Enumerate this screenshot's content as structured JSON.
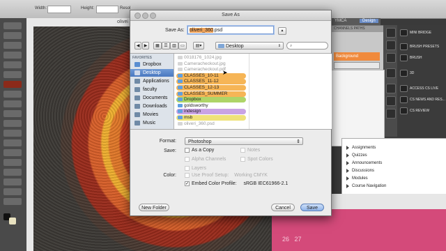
{
  "photoshop": {
    "options_bar": {
      "width_label": "Width:",
      "height_label": "Height:",
      "resolution_prefix": "Resol"
    },
    "doc_tab": "olivei",
    "panels": {
      "tabs": [
        "YMCA",
        "Design"
      ],
      "paths_label": "CHANNELS PATHS",
      "layer_label": "Background"
    },
    "extensions": [
      "MINI BRIDGE",
      "BRUSH PRESETS",
      "BRUSH",
      "3D",
      "ACCESS CS LIVE",
      "CS NEWS AND RES...",
      "CS REVIEW"
    ]
  },
  "course_menu": [
    "Assignments",
    "Quizzes",
    "Announcements",
    "Discussions",
    "Modules",
    "Course Navigation"
  ],
  "calendar_dates": [
    "26",
    "27"
  ],
  "dialog": {
    "title": "Save As",
    "save_as_label": "Save As:",
    "filename_selected": "oliveri_360",
    "filename_ext": ".psd",
    "location": "Desktop",
    "sidebar_heading": "FAVORITES",
    "sidebar_items": [
      "Dropbox",
      "Desktop",
      "Applications",
      "faculty",
      "Documents",
      "Downloads",
      "Movies",
      "Music"
    ],
    "files": [
      {
        "name": "0018176_1024.jpg",
        "style": "dim"
      },
      {
        "name": "Cameracheckout.jpg",
        "style": "dim"
      },
      {
        "name": "Cameracheckout.pdf",
        "style": "dim"
      },
      {
        "name": "CLASSES_10-11",
        "style": "orange"
      },
      {
        "name": "CLASSES_11-12",
        "style": "orange"
      },
      {
        "name": "CLASSES_12-13",
        "style": "orange"
      },
      {
        "name": "CLASSES_SUMMER",
        "style": "orange"
      },
      {
        "name": "Dropbox",
        "style": "green"
      },
      {
        "name": "goldsworthy",
        "style": "plain"
      },
      {
        "name": "indesign",
        "style": "purple"
      },
      {
        "name": "msb",
        "style": "yellow"
      },
      {
        "name": "oliveri_360.psd",
        "style": "dim"
      }
    ],
    "format_label": "Format:",
    "format_value": "Photoshop",
    "save_label": "Save:",
    "options": {
      "as_copy": "As a Copy",
      "notes": "Notes",
      "alpha_channels": "Alpha Channels",
      "spot_colors": "Spot Colors",
      "layers": "Layers"
    },
    "color_label": "Color:",
    "proof_setup": "Use Proof Setup:",
    "proof_value": "Working CMYK",
    "embed_profile": "Embed Color Profile:",
    "profile_value": "sRGB IEC61966-2.1",
    "buttons": {
      "new_folder": "New Folder",
      "cancel": "Cancel",
      "save": "Save"
    }
  }
}
